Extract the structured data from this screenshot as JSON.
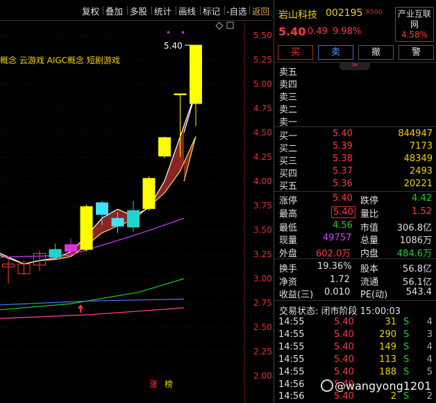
{
  "toolbar": {
    "buttons": [
      "复权",
      "叠加",
      "多股",
      "统计",
      "画线",
      "标记",
      "-自选"
    ],
    "back": "返回"
  },
  "concepts": "概念 云游戏 AIGC概念 短剧游戏",
  "chart_data": {
    "type": "candlestick",
    "price_axis": [
      "5.50",
      "5.25",
      "5.00",
      "4.75",
      "4.50",
      "4.25",
      "4.00",
      "3.75",
      "3.50",
      "3.25",
      "3.00",
      "2.75",
      "2.50",
      "2.25",
      "2.00"
    ],
    "ylim": [
      2.0,
      5.5
    ],
    "high_label": "5.40",
    "markers": [
      "涨",
      "榜"
    ],
    "candles": [
      {
        "o": 3.12,
        "c": 3.15,
        "h": 3.22,
        "l": 2.95
      },
      {
        "o": 3.05,
        "c": 3.15,
        "h": 3.19,
        "l": 3.04
      },
      {
        "o": 3.14,
        "c": 3.26,
        "h": 3.29,
        "l": 3.08
      },
      {
        "o": 3.3,
        "c": 3.22,
        "h": 3.36,
        "l": 3.2
      },
      {
        "o": 3.28,
        "c": 3.35,
        "h": 3.41,
        "l": 3.24
      },
      {
        "o": 3.3,
        "c": 3.74,
        "h": 3.76,
        "l": 3.28
      },
      {
        "o": 3.66,
        "c": 3.78,
        "h": 3.8,
        "l": 3.55
      },
      {
        "o": 3.54,
        "c": 3.62,
        "h": 3.68,
        "l": 3.47
      },
      {
        "o": 3.7,
        "c": 3.53,
        "h": 3.8,
        "l": 3.48
      },
      {
        "o": 3.72,
        "c": 4.03,
        "h": 4.05,
        "l": 3.7
      },
      {
        "o": 4.26,
        "c": 4.45,
        "h": 4.46,
        "l": 4.24
      },
      {
        "o": 4.9,
        "c": 4.9,
        "h": 4.9,
        "l": 4.25
      },
      {
        "o": 4.8,
        "c": 5.4,
        "h": 5.4,
        "l": 4.57
      }
    ]
  },
  "stock": {
    "name": "岩山科技",
    "code": "002195",
    "badge": "R500",
    "price": "5.40",
    "change": "0.49",
    "pct": "9.98%",
    "industry_name": "产业互联网",
    "industry_pct": "4.58%"
  },
  "actions": {
    "buy": "买",
    "sell": "卖",
    "cancel": "撤",
    "alert": "警"
  },
  "collapse_icon": "chevron-double-down-icon",
  "asks": [
    {
      "label": "卖五",
      "price": "",
      "vol": ""
    },
    {
      "label": "卖四",
      "price": "",
      "vol": ""
    },
    {
      "label": "卖三",
      "price": "",
      "vol": ""
    },
    {
      "label": "卖二",
      "price": "",
      "vol": ""
    },
    {
      "label": "卖一",
      "price": "",
      "vol": ""
    }
  ],
  "bids": [
    {
      "label": "买一",
      "price": "5.40",
      "vol": "844947"
    },
    {
      "label": "买二",
      "price": "5.39",
      "vol": "7173"
    },
    {
      "label": "买三",
      "price": "5.38",
      "vol": "48349"
    },
    {
      "label": "买四",
      "price": "5.37",
      "vol": "2493"
    },
    {
      "label": "买五",
      "price": "5.36",
      "vol": "20221"
    }
  ],
  "stats": {
    "zt_label": "涨停",
    "zt": "5.40",
    "dt_label": "跌停",
    "dt": "4.42",
    "high_label": "最高",
    "high": "5.40",
    "lb_label": "量比",
    "lb": "1.52",
    "low_label": "最低",
    "low": "4.56",
    "mv_label": "市值",
    "mv": "306.8亿",
    "cur_label": "现量",
    "cur": "49757",
    "tot_label": "总量",
    "tot": "1086万",
    "out_label": "外盘",
    "out": "602.0万",
    "in_label": "内盘",
    "in": "484.6万",
    "hs_label": "换手",
    "hs": "19.36%",
    "gb_label": "股本",
    "gb": "56.8亿",
    "jz_label": "净资",
    "jz": "1.72",
    "lt_label": "流通",
    "lt": "56.1亿",
    "sy_label": "收益(三)",
    "sy": "0.010",
    "pe_label": "PE(动)",
    "pe": "543.4"
  },
  "status": "交易状态: 闭市阶段 15:00:03",
  "ticks": [
    {
      "t": "14:55",
      "p": "5.40",
      "q": "31",
      "s": "S",
      "n": "4"
    },
    {
      "t": "14:55",
      "p": "5.40",
      "q": "290",
      "s": "S",
      "n": "3"
    },
    {
      "t": "14:55",
      "p": "5.40",
      "q": "149",
      "s": "S",
      "n": "4"
    },
    {
      "t": "14:55",
      "p": "5.40",
      "q": "113",
      "s": "S",
      "n": "4"
    },
    {
      "t": "14:55",
      "p": "5.40",
      "q": "188",
      "s": "S",
      "n": "5"
    },
    {
      "t": "14:56",
      "p": "5.40",
      "q": "",
      "s": "",
      "n": ""
    },
    {
      "t": "14:56",
      "p": "5.40",
      "q": "2",
      "s": "S",
      "n": "2"
    }
  ],
  "watermark": "@wangyong1201"
}
